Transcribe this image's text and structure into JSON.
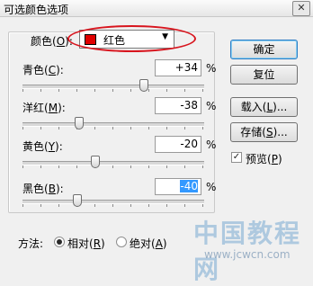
{
  "window": {
    "title": "可选颜色选项",
    "close_glyph": "✕"
  },
  "colors": {
    "label": "颜色",
    "accel": "O",
    "selected": "红色",
    "swatch": "#e00000",
    "arrow": "▼"
  },
  "sliders": [
    {
      "label": "青色",
      "accel": "C",
      "value": "+34",
      "unit": "%",
      "position_fraction": 0.67
    },
    {
      "label": "洋红",
      "accel": "M",
      "value": "-38",
      "unit": "%",
      "position_fraction": 0.31
    },
    {
      "label": "黄色",
      "accel": "Y",
      "value": "-20",
      "unit": "%",
      "position_fraction": 0.4
    },
    {
      "label": "黑色",
      "accel": "B",
      "value": "-40",
      "unit": "%",
      "position_fraction": 0.3
    }
  ],
  "buttons": {
    "ok": "确定",
    "reset": "复位",
    "load_label": "载入",
    "load_accel": "L",
    "load_suffix": "...",
    "save_label": "存储",
    "save_accel": "S",
    "save_suffix": "..."
  },
  "preview": {
    "label": "预览",
    "accel": "P",
    "checked": true,
    "check_glyph": "✓"
  },
  "method": {
    "label": "方法:",
    "relative_label": "相对",
    "relative_accel": "R",
    "relative_selected": true,
    "absolute_label": "绝对",
    "absolute_accel": "A"
  },
  "watermark": {
    "text": "中国教程网",
    "url": "www.jcwcn.com"
  }
}
